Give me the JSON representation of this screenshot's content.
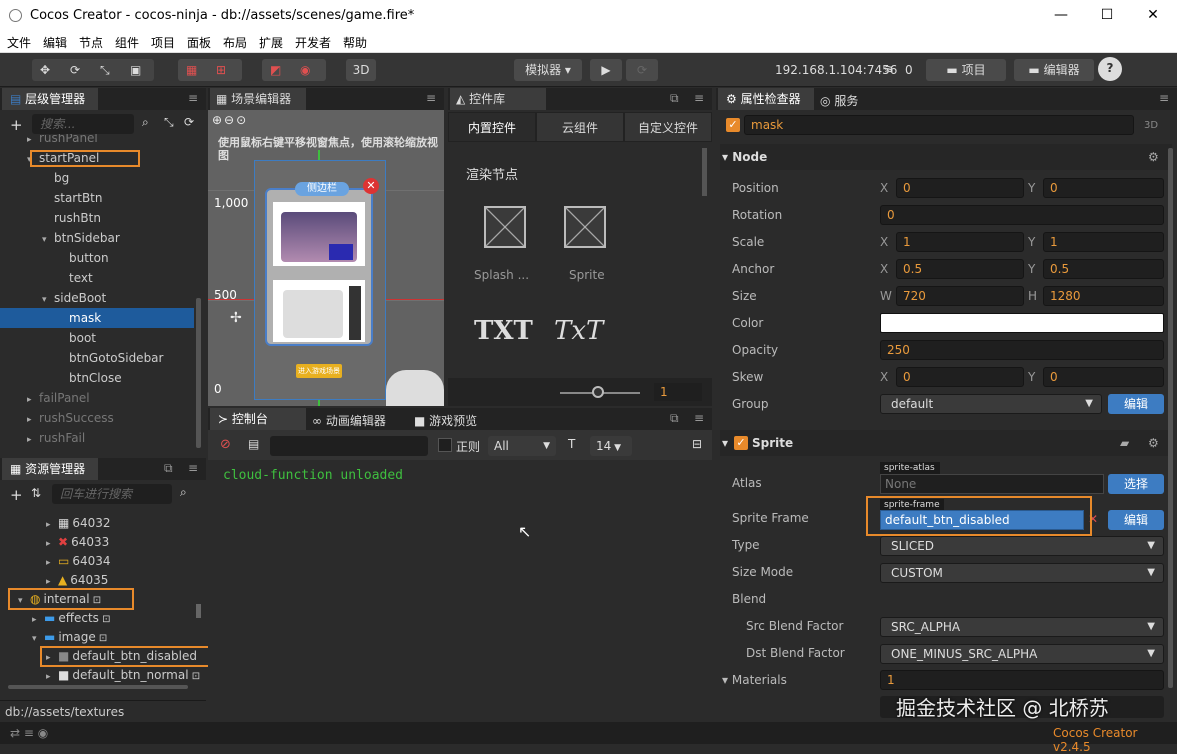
{
  "window": {
    "title": "Cocos Creator - cocos-ninja - db://assets/scenes/game.fire*",
    "min": "—",
    "max": "☐",
    "close": "✕"
  },
  "menu": [
    "文件",
    "编辑",
    "节点",
    "组件",
    "项目",
    "面板",
    "布局",
    "扩展",
    "开发者",
    "帮助"
  ],
  "toolbar": {
    "btn3d": "3D",
    "simulator": "模拟器 ▾",
    "ip": "192.168.1.104:7456",
    "wifi_count": "0",
    "project": "项目",
    "editor": "编辑器",
    "help": "?"
  },
  "hierarchy": {
    "title": "层级管理器",
    "search_placeholder": "搜索...",
    "items": [
      {
        "label": "rushPanel",
        "indent": 1,
        "arrow": "▸",
        "dim": true
      },
      {
        "label": "startPanel",
        "indent": 1,
        "arrow": "▾"
      },
      {
        "label": "bg",
        "indent": 2,
        "arrow": ""
      },
      {
        "label": "startBtn",
        "indent": 2,
        "arrow": ""
      },
      {
        "label": "rushBtn",
        "indent": 2,
        "arrow": ""
      },
      {
        "label": "btnSidebar",
        "indent": 2,
        "arrow": "▾"
      },
      {
        "label": "button",
        "indent": 3,
        "arrow": ""
      },
      {
        "label": "text",
        "indent": 3,
        "arrow": ""
      },
      {
        "label": "sideBoot",
        "indent": 2,
        "arrow": "▾"
      },
      {
        "label": "mask",
        "indent": 3,
        "arrow": "",
        "selected": true
      },
      {
        "label": "boot",
        "indent": 3,
        "arrow": ""
      },
      {
        "label": "btnGotoSidebar",
        "indent": 3,
        "arrow": ""
      },
      {
        "label": "btnClose",
        "indent": 3,
        "arrow": ""
      },
      {
        "label": "failPanel",
        "indent": 1,
        "arrow": "▸",
        "dim": true
      },
      {
        "label": "rushSuccess",
        "indent": 1,
        "arrow": "▸",
        "dim": true
      },
      {
        "label": "rushFail",
        "indent": 1,
        "arrow": "▸",
        "dim": true
      }
    ]
  },
  "assets": {
    "title": "资源管理器",
    "search_placeholder": "回车进行搜索",
    "items": [
      {
        "label": "64032",
        "indent": 3,
        "arrow": "▸"
      },
      {
        "label": "64033",
        "indent": 3,
        "arrow": "▸"
      },
      {
        "label": "64034",
        "indent": 3,
        "arrow": "▸"
      },
      {
        "label": "64035",
        "indent": 3,
        "arrow": "▸"
      },
      {
        "label": "internal",
        "indent": 1,
        "arrow": "▾"
      },
      {
        "label": "effects",
        "indent": 2,
        "arrow": "▸"
      },
      {
        "label": "image",
        "indent": 2,
        "arrow": "▾"
      },
      {
        "label": "default_btn_disabled",
        "indent": 3,
        "arrow": "▸"
      },
      {
        "label": "default_btn_normal",
        "indent": 3,
        "arrow": "▸"
      }
    ],
    "path": "db://assets/textures"
  },
  "scene": {
    "title": "场景编辑器",
    "hint": "使用鼠标右键平移视窗焦点，使用滚轮缩放视图",
    "y1000": "1,000",
    "y500": "500",
    "y0": "0",
    "x0": "0",
    "sidebar_title": "侧边栏",
    "enter_btn": "进入游戏场景"
  },
  "widgets": {
    "title": "控件库",
    "tabs": [
      "内置控件",
      "云组件",
      "自定义控件"
    ],
    "section": "渲染节点",
    "items": [
      "Splash ...",
      "Sprite"
    ],
    "txt1": "TXT",
    "txt2": "TxT",
    "slider_value": "1"
  },
  "console": {
    "tabs": [
      "控制台",
      "动画编辑器",
      "游戏预览"
    ],
    "regex": "正则",
    "level": "All",
    "fontsize": "14",
    "log": "cloud-function unloaded"
  },
  "inspector": {
    "tabs": [
      "属性检查器",
      "服务"
    ],
    "node_name": "mask",
    "dim3d": "3D",
    "node_section": "Node",
    "position": {
      "x": "0",
      "y": "0"
    },
    "rotation": "0",
    "scale": {
      "x": "1",
      "y": "1"
    },
    "anchor": {
      "x": "0.5",
      "y": "0.5"
    },
    "size": {
      "w": "720",
      "h": "1280"
    },
    "color": "#ffffff",
    "opacity": "250",
    "skew": {
      "x": "0",
      "y": "0"
    },
    "group": "default",
    "labels": {
      "position": "Position",
      "rotation": "Rotation",
      "scale": "Scale",
      "anchor": "Anchor",
      "size": "Size",
      "color": "Color",
      "opacity": "Opacity",
      "skew": "Skew",
      "group": "Group",
      "x": "X",
      "y": "Y",
      "w": "W",
      "h": "H"
    },
    "edit": "编辑",
    "sprite_section": "Sprite",
    "atlas_label": "Atlas",
    "atlas_tag": "sprite-atlas",
    "atlas_value": "None",
    "choose": "选择",
    "frame_label": "Sprite Frame",
    "frame_tag": "sprite-frame",
    "frame_value": "default_btn_disabled",
    "type_label": "Type",
    "type_value": "SLICED",
    "sizemode_label": "Size Mode",
    "sizemode_value": "CUSTOM",
    "blend_label": "Blend",
    "src_label": "Src Blend Factor",
    "src_value": "SRC_ALPHA",
    "dst_label": "Dst Blend Factor",
    "dst_value": "ONE_MINUS_SRC_ALPHA",
    "materials_label": "Materials",
    "materials_value": "1",
    "watermark": "掘金技术社区 @ 北桥苏"
  },
  "status": {
    "version": "Cocos Creator v2.4.5"
  }
}
